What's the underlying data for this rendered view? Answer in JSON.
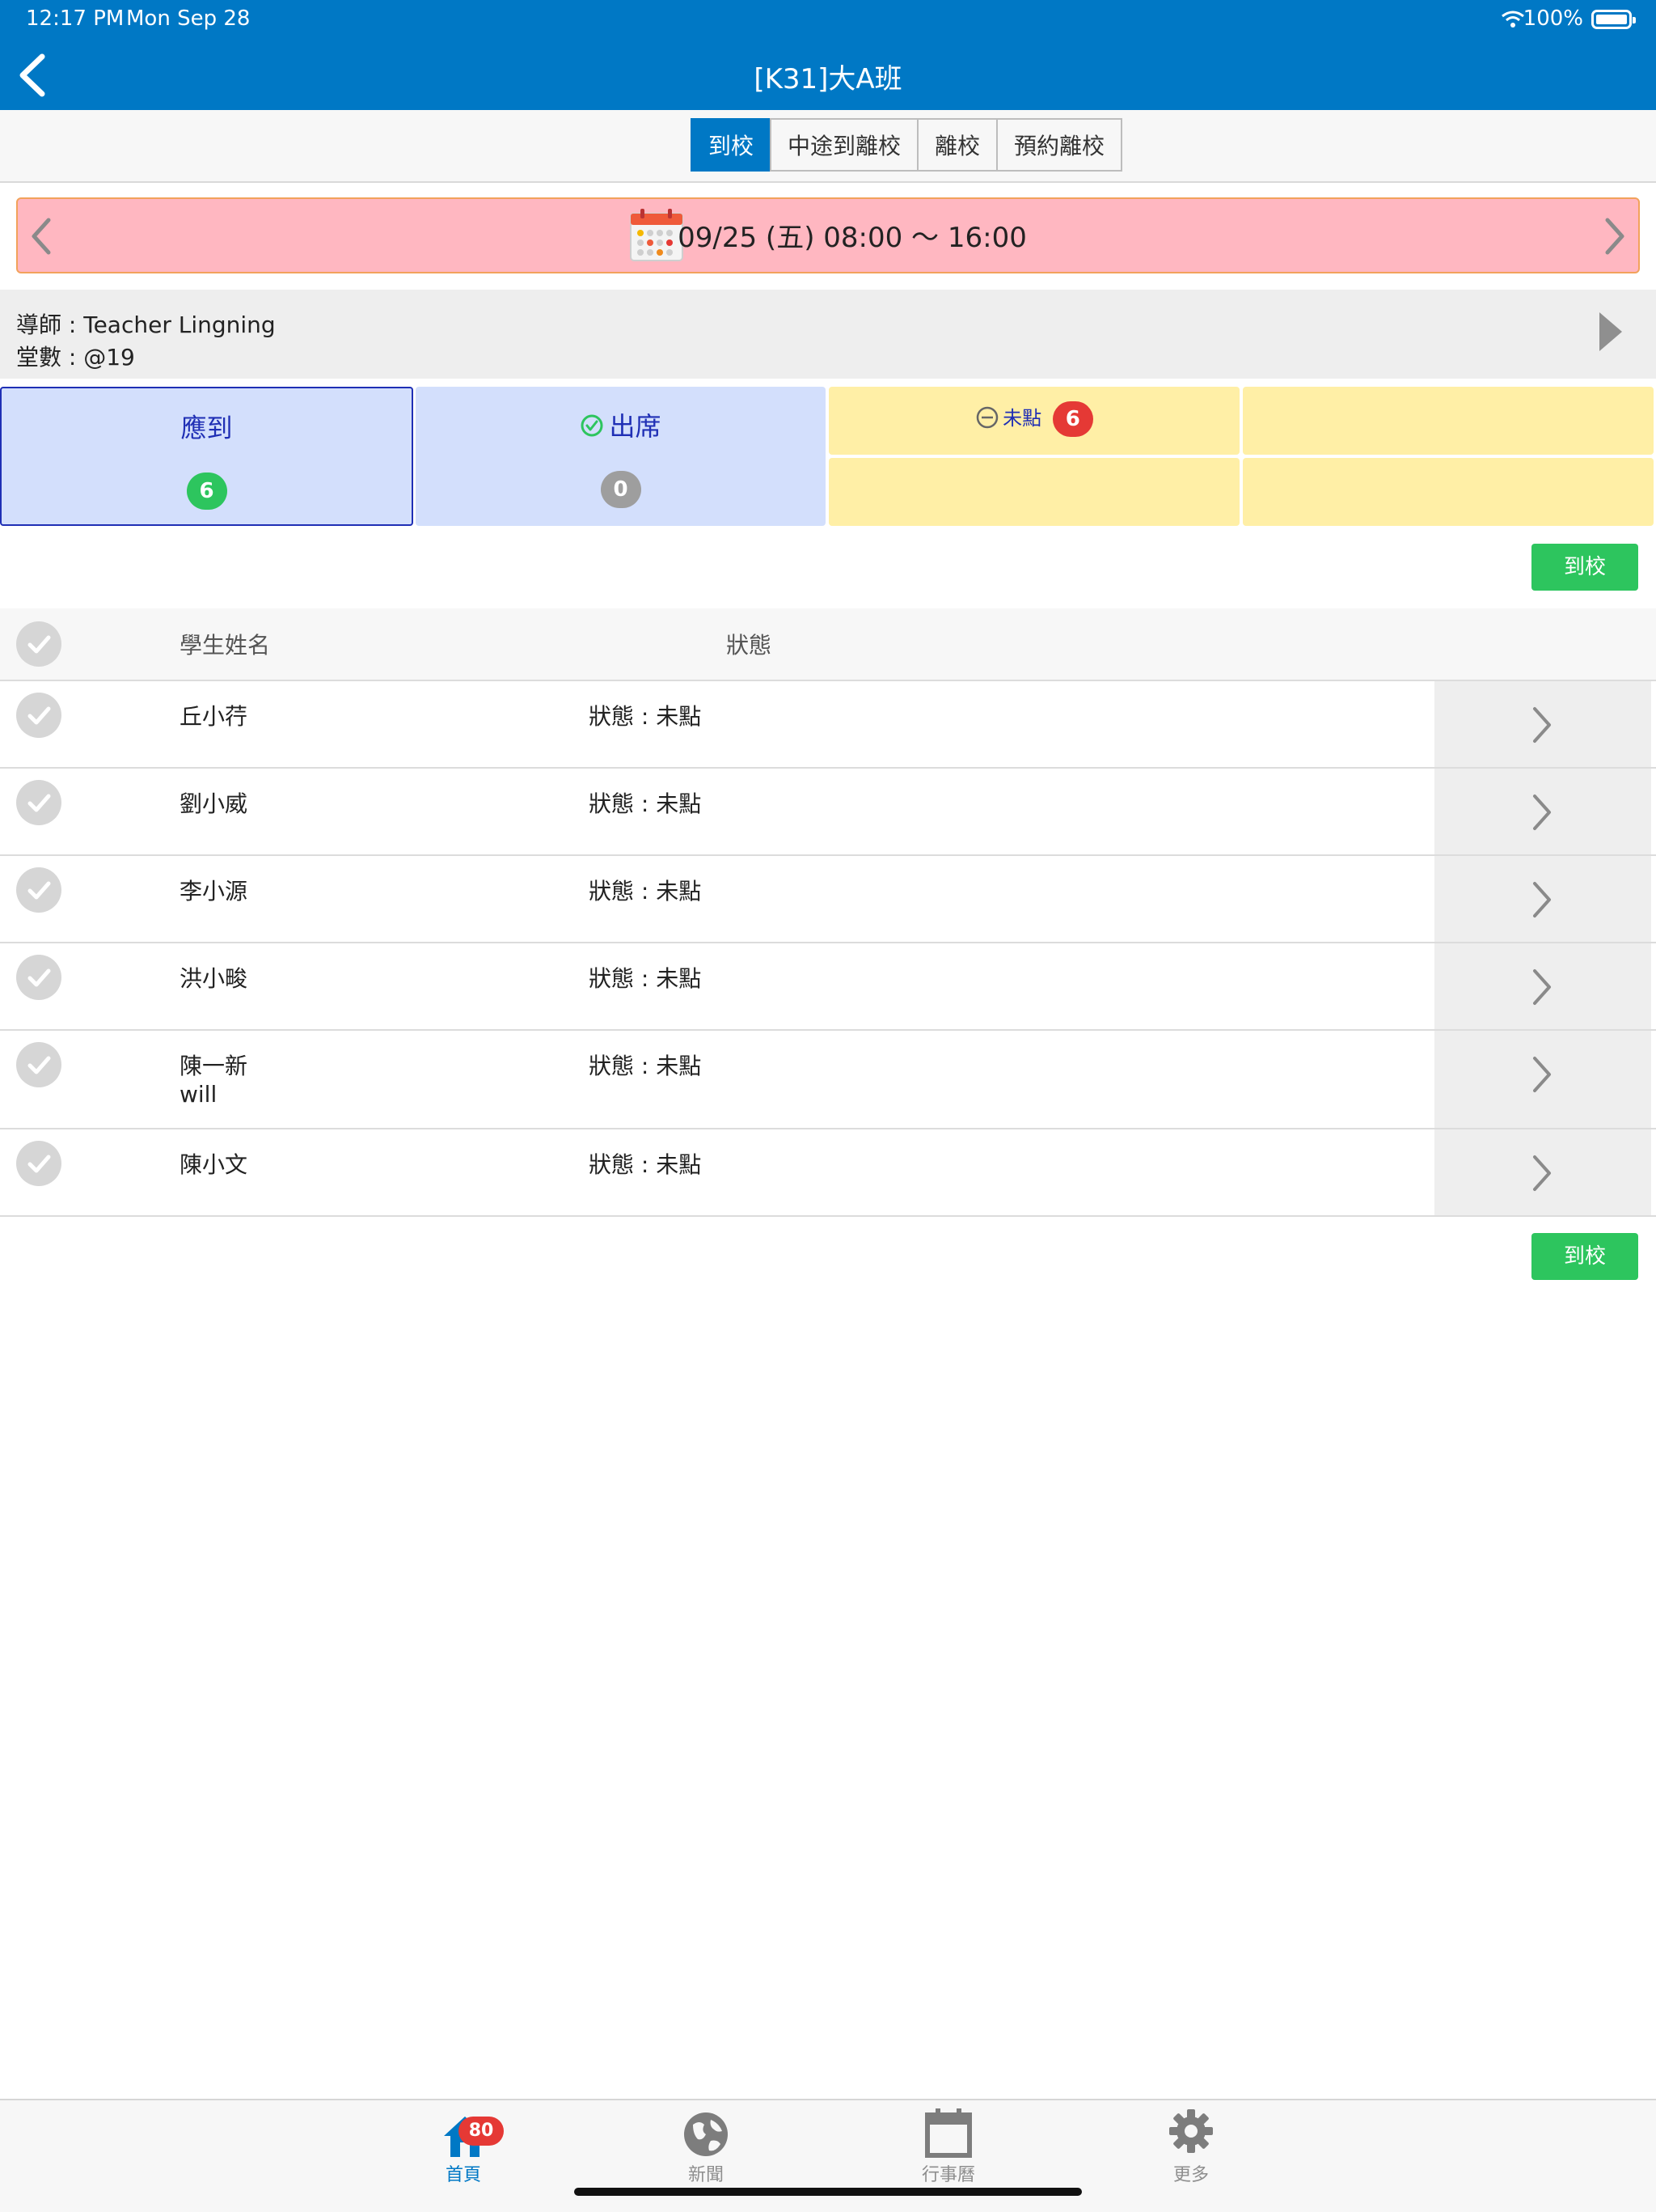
{
  "status_bar": {
    "time": "12:17 PM",
    "date": "Mon Sep 28",
    "battery": "100%"
  },
  "nav": {
    "title": "[K31]大A班"
  },
  "tabs": [
    {
      "label": "到校",
      "active": true
    },
    {
      "label": "中途到離校",
      "active": false
    },
    {
      "label": "離校",
      "active": false
    },
    {
      "label": "預約離校",
      "active": false
    }
  ],
  "date_bar": {
    "text": "09/25 (五) 08:00 ～ 16:00"
  },
  "info": {
    "teacher": "導師 : Teacher Lingning",
    "lesson": "堂數 : @19"
  },
  "stats": {
    "expected": {
      "label": "應到",
      "count": "6"
    },
    "present": {
      "label": "出席",
      "count": "0"
    },
    "unmarked": {
      "label": "未點",
      "count": "6"
    }
  },
  "actions": {
    "arrive_label": "到校"
  },
  "table": {
    "headers": {
      "name": "學生姓名",
      "status": "狀態"
    },
    "rows": [
      {
        "name": "丘小荇",
        "sub": "",
        "status": "狀態 : 未點"
      },
      {
        "name": "劉小威",
        "sub": "",
        "status": "狀態 : 未點"
      },
      {
        "name": "李小源",
        "sub": "",
        "status": "狀態 : 未點"
      },
      {
        "name": "洪小畯",
        "sub": "",
        "status": "狀態 : 未點"
      },
      {
        "name": "陳一新",
        "sub": "will",
        "status": "狀態 : 未點"
      },
      {
        "name": "陳小文",
        "sub": "",
        "status": "狀態 : 未點"
      }
    ]
  },
  "bottom_tabs": [
    {
      "label": "首頁",
      "icon": "home-icon",
      "badge": "80",
      "active": true
    },
    {
      "label": "新聞",
      "icon": "globe-icon",
      "active": false
    },
    {
      "label": "行事曆",
      "icon": "calendar-icon",
      "active": false
    },
    {
      "label": "更多",
      "icon": "gear-icon",
      "active": false
    }
  ],
  "colors": {
    "primary": "#0078C5",
    "date_bg": "#FFB7C1",
    "card_blue": "#D3DFFC",
    "card_yellow": "#FFEFA6",
    "green": "#2DC55E",
    "red": "#E53935"
  }
}
